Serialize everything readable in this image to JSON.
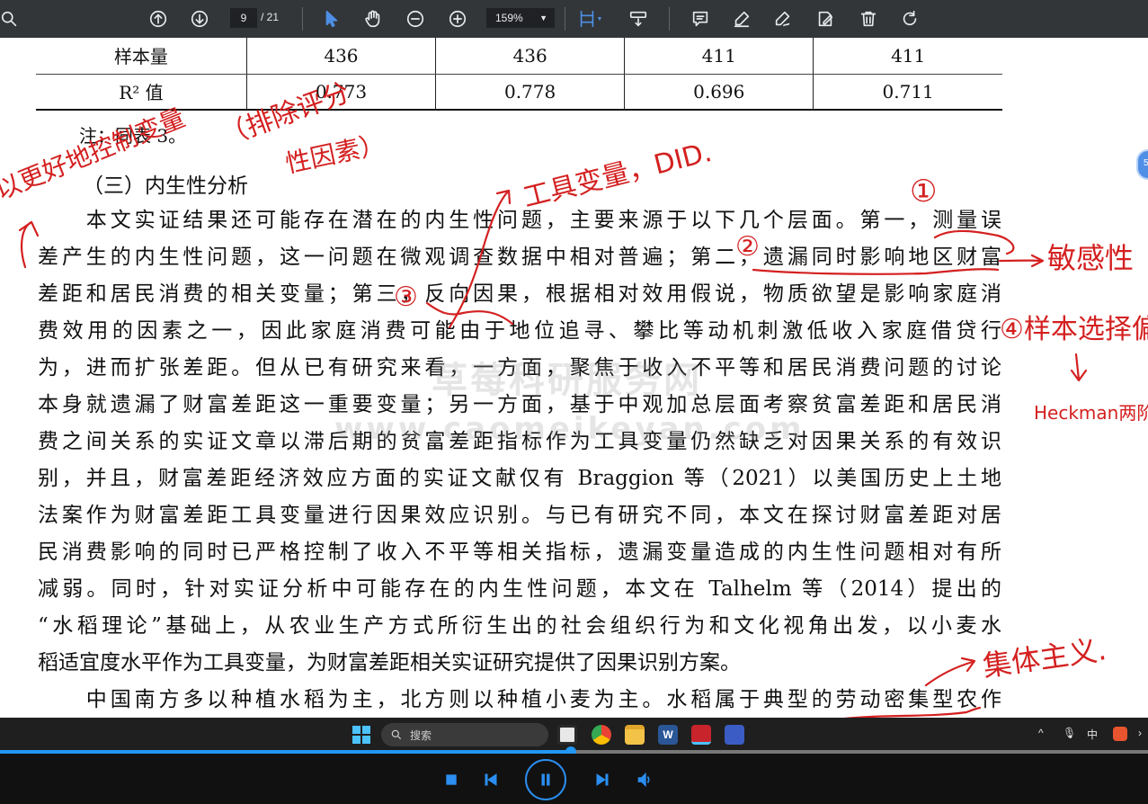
{
  "toolbar": {
    "page_current": "9",
    "page_total": "/ 21",
    "zoom": "159%"
  },
  "table": {
    "rows": [
      {
        "label": "样本量",
        "values": [
          "436",
          "436",
          "411",
          "411"
        ]
      },
      {
        "label": "R² 值",
        "values": [
          "0.773",
          "0.778",
          "0.696",
          "0.711"
        ]
      }
    ]
  },
  "doc": {
    "note": "注：同表 3。",
    "section_heading": "（三）内生性分析",
    "lines": [
      "　　本文实证结果还可能存在潜在的内生性问题，主要来源于以下几个层面。第一，测量误",
      "差产生的内生性问题，这一问题在微观调查数据中相对普遍；第二，遗漏同时影响地区财富",
      "差距和居民消费的相关变量；第三，反向因果，根据相对效用假说，物质欲望是影响家庭消",
      "费效用的因素之一，因此家庭消费可能由于地位追寻、攀比等动机刺激低收入家庭借贷行",
      "为，进而扩张差距。但从已有研究来看，一方面，聚焦于收入不平等和居民消费问题的讨论",
      "本身就遗漏了财富差距这一重要变量；另一方面，基于中观加总层面考察贫富差距和居民消",
      "费之间关系的实证文章以滞后期的贫富差距指标作为工具变量仍然缺乏对因果关系的有效识",
      "别，并且，财富差距经济效应方面的实证文献仅有 Braggion 等（2021）以美国历史上土地",
      "法案作为财富差距工具变量进行因果效应识别。与已有研究不同，本文在探讨财富差距对居",
      "民消费影响的同时已严格控制了收入不平等相关指标，遗漏变量造成的内生性问题相对有所",
      "减弱。同时，针对实证分析中可能存在的内生性问题，本文在 Talhelm 等（2014）提出的",
      "“水稻理论”基础上，从农业生产方式所衍生出的社会组织行为和文化视角出发，以小麦水",
      "稻适宜度水平作为工具变量，为财富差距相关实证研究提供了因果识别方案。",
      "　　中国南方多以种植水稻为主，北方则以种植小麦为主。水稻属于典型的劳动密集型农作"
    ],
    "watermark_cn": "草莓科研服务网",
    "watermark_url": "www.caomeikeyan.com"
  },
  "annotations": {
    "a1": "以更好地控制变量",
    "a2": "（排除评分",
    "a3": "性因素）",
    "a4": "工具变量，DID.",
    "a5": "①",
    "a6": "②",
    "a7": "③",
    "a8": "敏感性",
    "a9": "④样本选择偏",
    "a10": "Heckman两阶",
    "a11": "集体主义."
  },
  "taskbar": {
    "search_placeholder": "搜索",
    "ime": "中"
  },
  "player": {
    "progress": 0.497
  },
  "colors": {
    "ink": "#d42020",
    "accent": "#2196f3"
  }
}
